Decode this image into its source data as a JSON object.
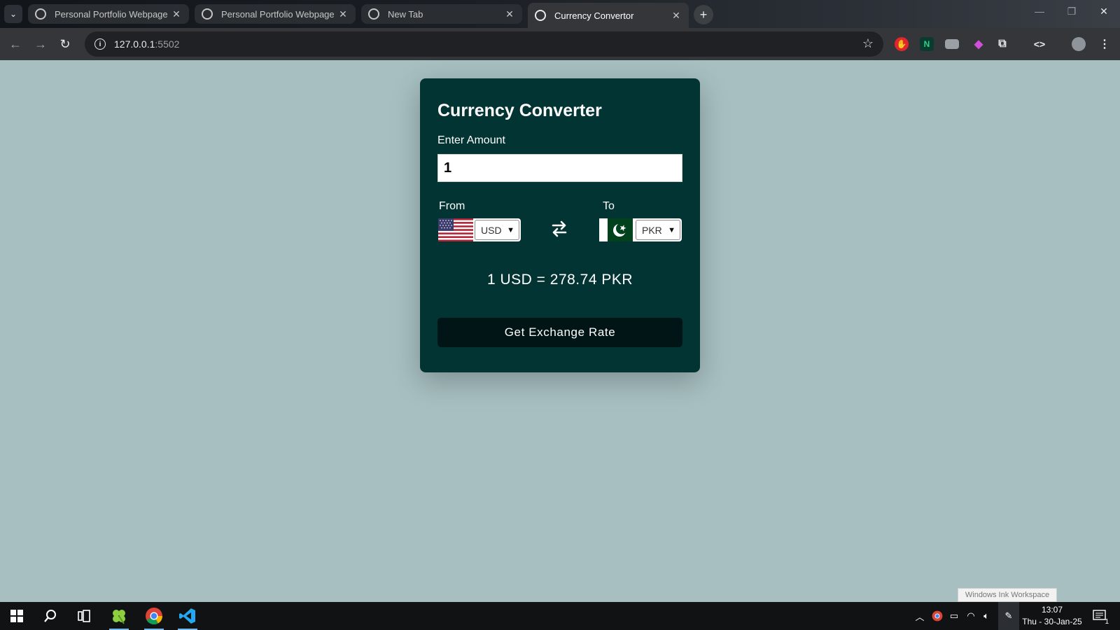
{
  "browser": {
    "tabs": [
      {
        "title": "Personal Portfolio Webpage",
        "active": false
      },
      {
        "title": "Personal Portfolio Webpage",
        "active": false
      },
      {
        "title": "New Tab",
        "active": false
      },
      {
        "title": "Currency Convertor",
        "active": true
      }
    ],
    "close_glyph": "✕",
    "new_tab_glyph": "+",
    "url_host": "127.0.0.1",
    "url_port": ":5502"
  },
  "app": {
    "title": "Currency Converter",
    "amount_label": "Enter Amount",
    "amount_value": "1",
    "from_label": "From",
    "to_label": "To",
    "from_currency": "USD",
    "to_currency": "PKR",
    "rate_text": "1 USD = 278.74 PKR",
    "button_label": "Get Exchange Rate"
  },
  "tooltip": "Windows Ink Workspace",
  "taskbar": {
    "time": "13:07",
    "date": "Thu - 30-Jan-25",
    "notification_count": "1"
  },
  "colors": {
    "page_bg": "#a7bfc0",
    "card_bg": "#033434",
    "button_bg": "#011416"
  }
}
